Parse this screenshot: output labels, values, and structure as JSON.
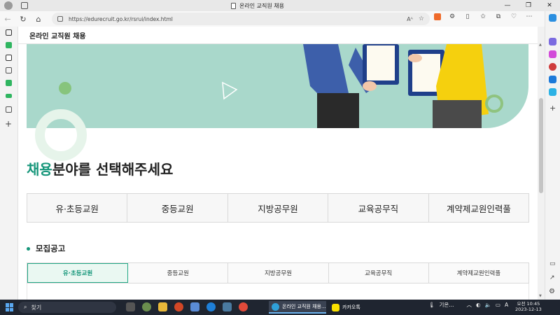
{
  "browser": {
    "tab_title": "온라인 교직원 채용",
    "url": "https://edurecruit.go.kr/rsrui/index.html",
    "read_aloud": "Aᴬ"
  },
  "page": {
    "header_title": "온라인 교직원 채용",
    "heading_accent": "채용",
    "heading_rest": "분야를 선택해주세요",
    "categories": [
      "유·초등교원",
      "중등교원",
      "지방공무원",
      "교육공무직",
      "계약제교원인력풀"
    ],
    "notice_title": "모집공고",
    "notice_tabs": [
      "유·초등교원",
      "중등교원",
      "지방공무원",
      "교육공무직",
      "계약제교원인력풀"
    ]
  },
  "taskbar": {
    "search_label": "찾기",
    "app_edge_label": "온라인 교직원 채용...",
    "app_kakao_label": "카카오톡",
    "weather_label": "기온...",
    "time": "오전 10:45",
    "date": "2023-12-13"
  },
  "colors": {
    "accent": "#16967a",
    "banner": "#a9d8cb"
  }
}
